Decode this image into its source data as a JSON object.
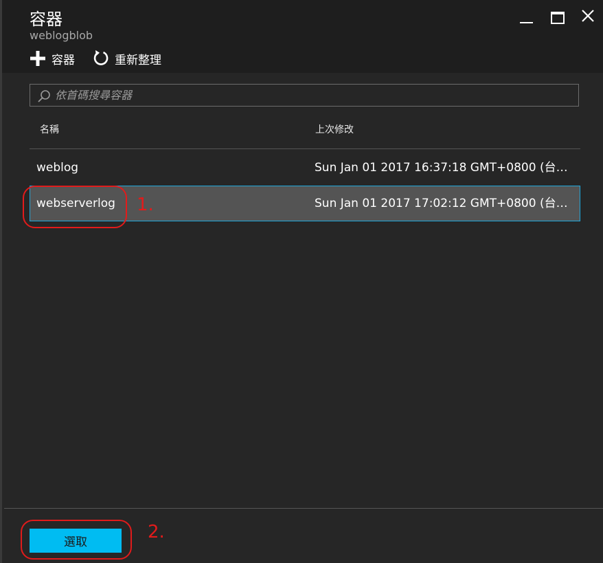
{
  "window": {
    "title": "容器",
    "subtitle": "weblogblob"
  },
  "toolbar": {
    "add_label": "容器",
    "refresh_label": "重新整理"
  },
  "search": {
    "placeholder": "依首碼搜尋容器",
    "value": ""
  },
  "table": {
    "columns": [
      "名稱",
      "上次修改"
    ],
    "rows": [
      {
        "name": "weblog",
        "modified": "Sun Jan 01 2017 16:37:18 GMT+0800 (台北標..."
      },
      {
        "name": "webserverlog",
        "modified": "Sun Jan 01 2017 17:02:12 GMT+0800 (台北標..."
      }
    ]
  },
  "footer": {
    "select_label": "選取"
  },
  "annotations": {
    "step1": "1.",
    "step2": "2."
  },
  "colors": {
    "accent": "#00bcf2",
    "selected_row": "#545454",
    "selected_border": "#1fa8dc",
    "annotation": "#e21b1b"
  }
}
